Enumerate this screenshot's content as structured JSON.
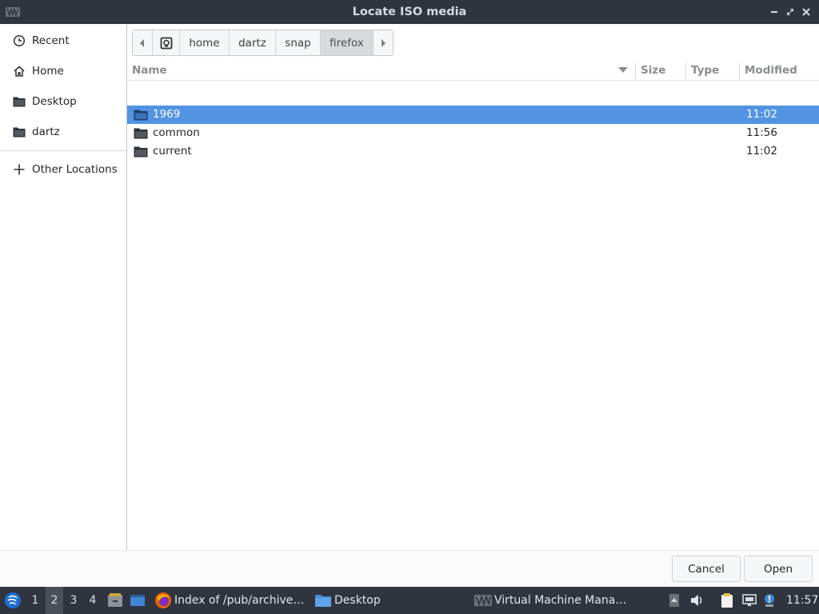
{
  "window": {
    "title": "Locate ISO media"
  },
  "sidebar": {
    "items": [
      {
        "label": "Recent",
        "icon": "clock-icon"
      },
      {
        "label": "Home",
        "icon": "home-icon"
      },
      {
        "label": "Desktop",
        "icon": "folder-icon"
      },
      {
        "label": "dartz",
        "icon": "folder-icon"
      },
      {
        "label": "Other Locations",
        "icon": "plus-icon"
      }
    ]
  },
  "pathbar": {
    "segments": [
      "home",
      "dartz",
      "snap",
      "firefox"
    ],
    "active": "firefox"
  },
  "filelist": {
    "columns": [
      "Name",
      "Size",
      "Type",
      "Modified"
    ],
    "rows": [
      {
        "name": "1969",
        "size": "",
        "type": "",
        "modified": "11:02",
        "selected": true
      },
      {
        "name": "common",
        "size": "",
        "type": "",
        "modified": "11:56",
        "selected": false
      },
      {
        "name": "current",
        "size": "",
        "type": "",
        "modified": "11:02",
        "selected": false
      }
    ]
  },
  "footer": {
    "cancel_label": "Cancel",
    "open_label": "Open"
  },
  "taskbar": {
    "workspaces": [
      "1",
      "2",
      "3",
      "4"
    ],
    "active_workspace": "2",
    "tasks": [
      {
        "label": "Index of /pub/archive…",
        "icon": "firefox-icon"
      },
      {
        "label": "Desktop",
        "icon": "folder-icon"
      },
      {
        "label": "Virtual Machine Mana…",
        "icon": "virt-manager-icon"
      }
    ],
    "clock": "11:57"
  },
  "colors": {
    "selection": "#5294e2",
    "titlebar": "#2f343f",
    "taskbar": "#2f343f"
  }
}
